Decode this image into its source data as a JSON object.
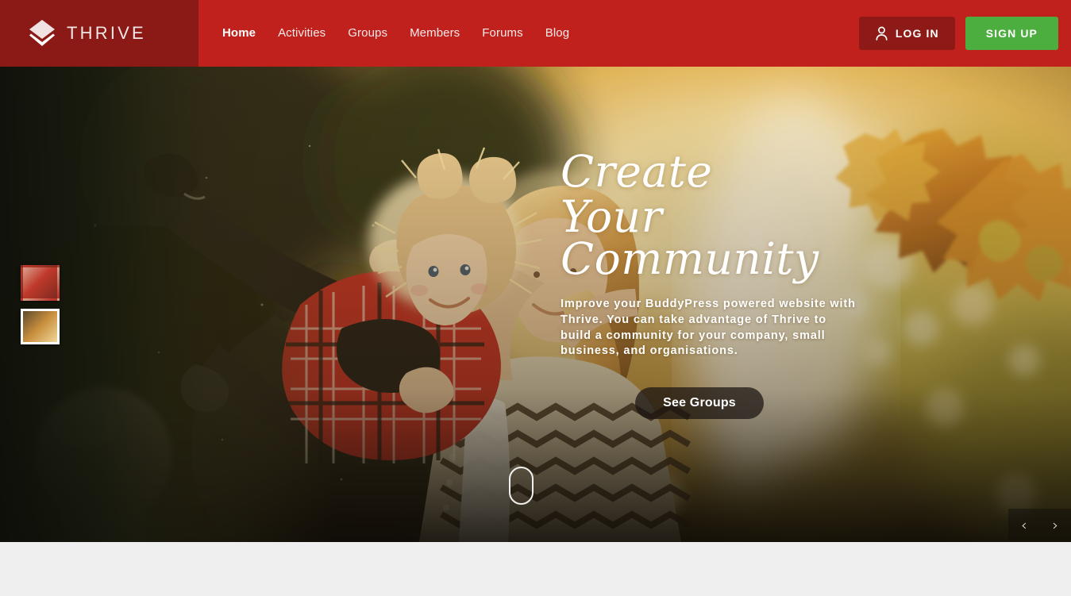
{
  "brand": {
    "name": "THRIVE",
    "logo_icon": "layers-diamond-icon",
    "logo_bg": "#8b1a17",
    "header_bg": "#c0211c"
  },
  "nav": {
    "items": [
      {
        "label": "Home",
        "active": true
      },
      {
        "label": "Activities",
        "active": false
      },
      {
        "label": "Groups",
        "active": false
      },
      {
        "label": "Members",
        "active": false
      },
      {
        "label": "Forums",
        "active": false
      },
      {
        "label": "Blog",
        "active": false
      }
    ]
  },
  "header_actions": {
    "login_label": "LOG IN",
    "login_icon": "user-icon",
    "login_bg": "#8d1a17",
    "signup_label": "SIGN UP",
    "signup_bg": "#4cae3e"
  },
  "hero": {
    "title_line1": "Create",
    "title_line2": "Your Community",
    "description": "Improve your BuddyPress powered website with Thrive. You can take advantage of Thrive to build a community for your company, small business, and organisations.",
    "cta_label": "See Groups",
    "scroll_indicator_icon": "mouse-scroll-icon",
    "prev_icon": "chevron-left-icon",
    "next_icon": "chevron-right-icon",
    "prev_glyph": "‹",
    "next_glyph": "›",
    "slides": [
      {
        "name": "slide-thumb-1",
        "active": false
      },
      {
        "name": "slide-thumb-2",
        "active": true
      }
    ]
  }
}
